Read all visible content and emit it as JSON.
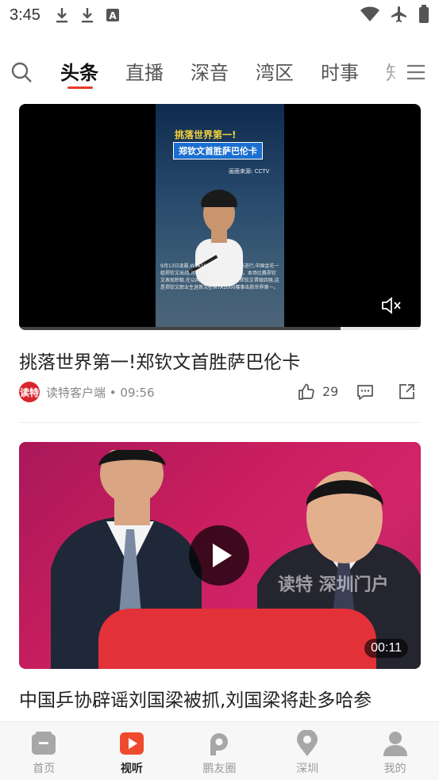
{
  "status_bar": {
    "time": "3:45",
    "icons": [
      "download-icon",
      "download-icon",
      "a-box-icon",
      "wifi-icon",
      "airplane-icon",
      "battery-icon"
    ]
  },
  "channels": {
    "search_icon": "search-icon",
    "tabs": [
      {
        "label": "头条",
        "active": true
      },
      {
        "label": "直播",
        "active": false
      },
      {
        "label": "深音",
        "active": false
      },
      {
        "label": "湾区",
        "active": false
      },
      {
        "label": "时事",
        "active": false
      },
      {
        "label": "知",
        "active": false
      }
    ],
    "menu_icon": "menu-icon",
    "accent_color": "#e8392a"
  },
  "feed": [
    {
      "type": "video",
      "overlay_title_1": "挑落世界第一!",
      "overlay_title_2": "郑钦文首胜萨巴伦卡",
      "overlay_source": "画面来源: CCTV",
      "overlay_caption": "9月13日凌晨,WTA1000罗马站1/4决赛进行,中国金花一姐郑钦文出战,对手是世界第一萨巴伦卡。本场比赛郑钦文表现积极,在以两盘取胜世界第一后,郑钦文晋级四强,这是郑钦文职业生涯首次在WTA1000赛事击败世界第一。",
      "progress": 0.8,
      "title": "挑落世界第一!郑钦文首胜萨巴伦卡",
      "source_logo_text": "读特",
      "source": "读特客户端",
      "time": "09:56",
      "likes": "29"
    },
    {
      "type": "video",
      "watermark": "读特 深圳门户",
      "duration": "00:11",
      "title": "中国乒协辟谣刘国梁被抓,刘国梁将赴多哈参"
    }
  ],
  "bottom_nav": [
    {
      "label": "首页",
      "icon": "home-icon",
      "active": false
    },
    {
      "label": "视听",
      "icon": "video-play-icon",
      "active": true
    },
    {
      "label": "鹏友圈",
      "icon": "friends-circle-icon",
      "active": false
    },
    {
      "label": "深圳",
      "icon": "location-pin-icon",
      "active": false
    },
    {
      "label": "我的",
      "icon": "user-icon",
      "active": false
    }
  ],
  "colors": {
    "accent": "#e8392a",
    "logo_red": "#d9252d",
    "nav_active": "#222222",
    "nav_inactive": "#9a9a9a"
  }
}
